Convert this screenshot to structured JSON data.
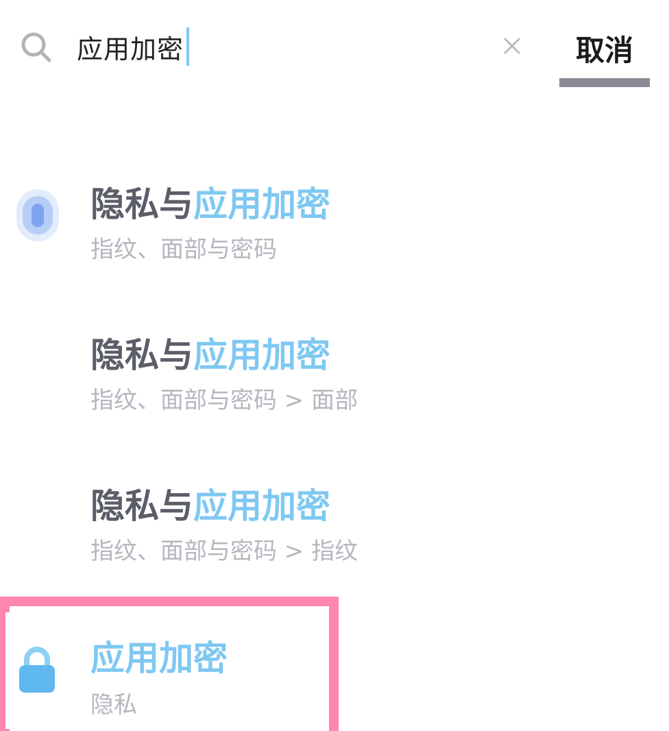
{
  "search": {
    "query": "应用加密",
    "cancel_label": "取消"
  },
  "results": [
    {
      "title_prefix": "隐私与",
      "title_highlight": "应用加密",
      "subtitle": "指纹、面部与密码"
    },
    {
      "title_prefix": "隐私与",
      "title_highlight": "应用加密",
      "subtitle": "指纹、面部与密码 > 面部"
    },
    {
      "title_prefix": "隐私与",
      "title_highlight": "应用加密",
      "subtitle": "指纹、面部与密码 > 指纹"
    },
    {
      "title_highlight": "应用加密",
      "subtitle": "隐私"
    }
  ],
  "icons": {
    "search": "search-icon",
    "clear": "close-icon",
    "fingerprint": "fingerprint-icon",
    "lock": "lock-icon"
  },
  "colors": {
    "highlight_text": "#7ec8f2",
    "caret": "#7cc6f2",
    "selection_border": "#ff86ad",
    "lock": "#5fb8f0"
  }
}
